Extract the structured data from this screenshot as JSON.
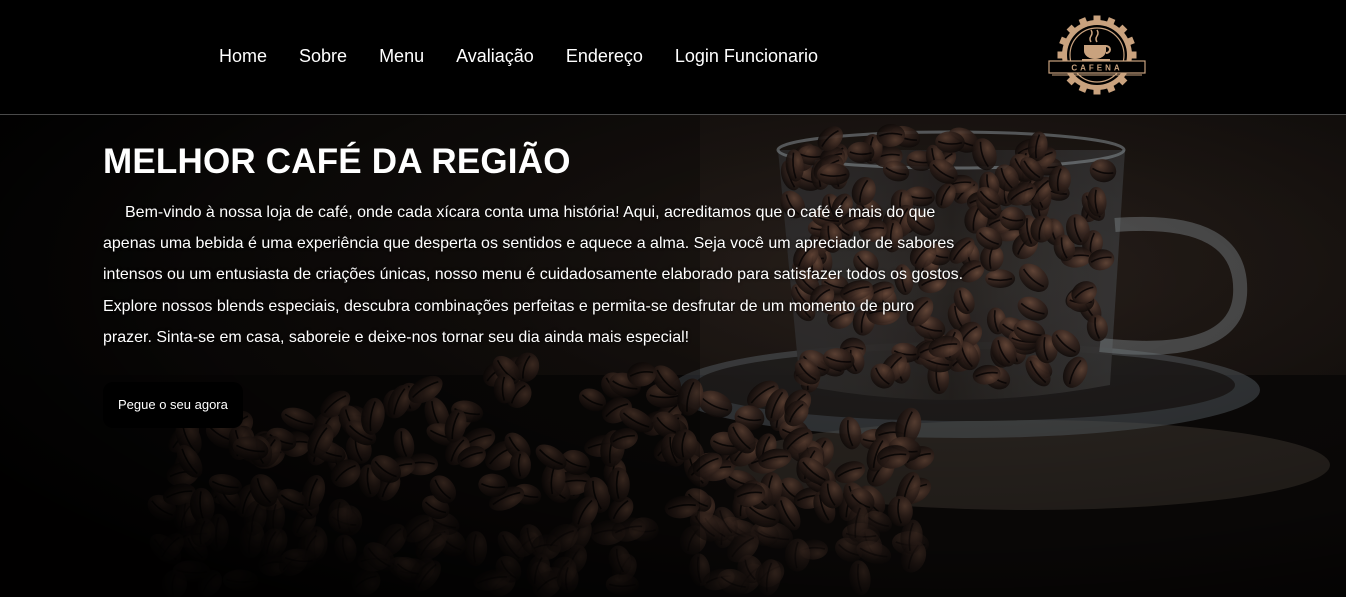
{
  "nav": {
    "items": [
      {
        "label": "Home"
      },
      {
        "label": "Sobre"
      },
      {
        "label": "Menu"
      },
      {
        "label": "Avaliação"
      },
      {
        "label": "Endereço"
      },
      {
        "label": "Login Funcionario"
      }
    ]
  },
  "logo": {
    "text": "CAFENA",
    "color": "#c9a27e"
  },
  "hero": {
    "title": "MELHOR CAFÉ DA REGIÃO",
    "text": "Bem-vindo à nossa loja de café, onde cada xícara conta uma história! Aqui, acreditamos que o café é mais do que apenas uma bebida é uma experiência que desperta os sentidos e aquece a alma. Seja você um apreciador de sabores intensos ou um entusiasta de criações únicas, nosso menu é cuidadosamente elaborado para satisfazer todos os gostos. Explore nossos blends especiais, descubra combinações perfeitas e permita-se desfrutar de um momento de puro prazer. Sinta-se em casa, saboreie e deixe-nos tornar seu dia ainda mais especial!",
    "cta_label": "Pegue o seu agora"
  }
}
